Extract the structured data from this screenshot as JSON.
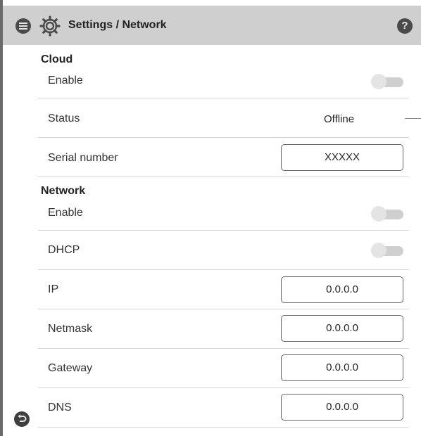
{
  "header": {
    "title": "Settings / Network",
    "help_label": "?"
  },
  "cloud": {
    "title": "Cloud",
    "enable_label": "Enable",
    "enable_on": false,
    "status_label": "Status",
    "status_value": "Offline",
    "serial_label": "Serial number",
    "serial_value": "XXXXX"
  },
  "network": {
    "title": "Network",
    "enable_label": "Enable",
    "enable_on": false,
    "dhcp_label": "DHCP",
    "dhcp_on": false,
    "ip_label": "IP",
    "ip_value": "0.0.0.0",
    "netmask_label": "Netmask",
    "netmask_value": "0.0.0.0",
    "gateway_label": "Gateway",
    "gateway_value": "0.0.0.0",
    "dns_label": "DNS",
    "dns_value": "0.0.0.0"
  },
  "icons": {
    "menu": "menu-icon",
    "settings": "gear-icon",
    "help": "help-icon",
    "back": "back-icon"
  },
  "colors": {
    "header_bg": "#cfcfcf",
    "icon_dark": "#4a4a4a",
    "toggle_off": "#cfcfcf"
  }
}
